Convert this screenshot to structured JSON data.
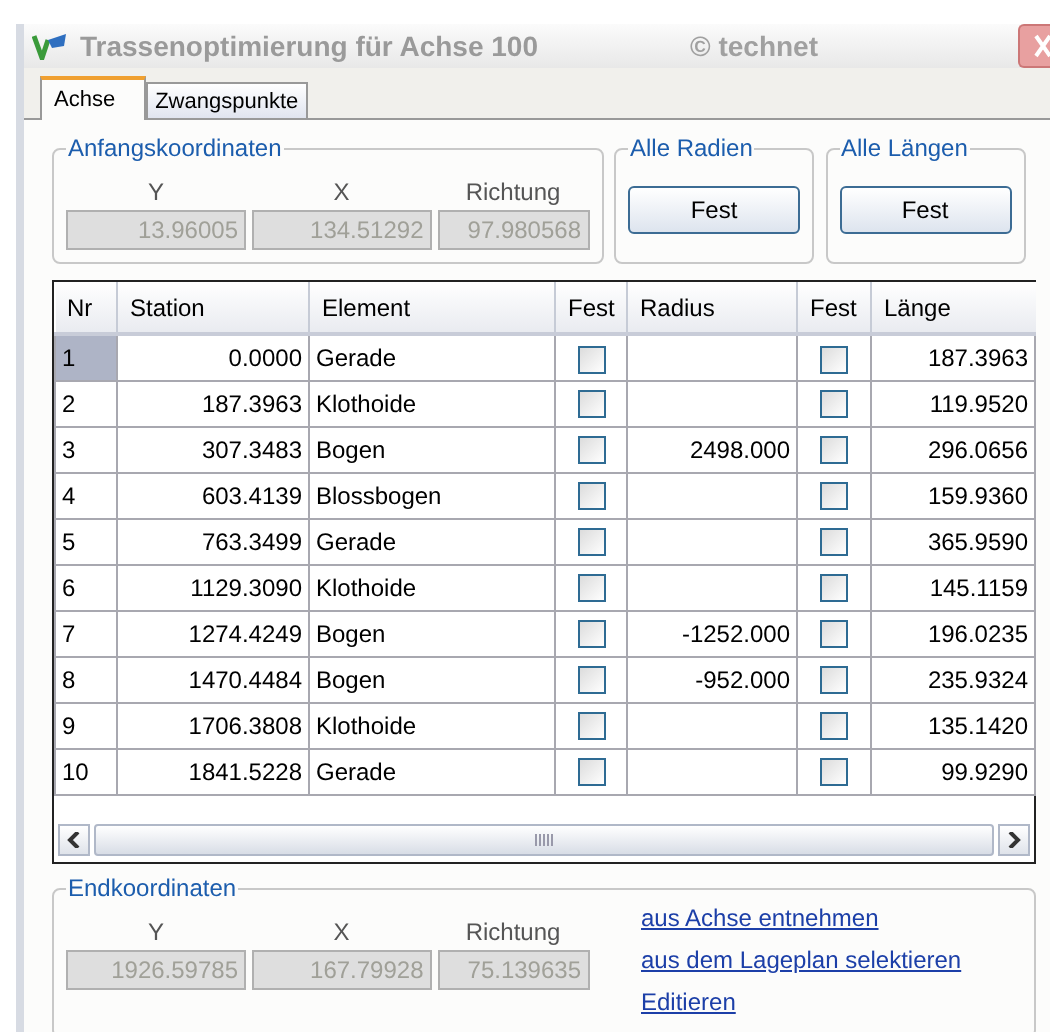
{
  "window": {
    "title": "Trassenoptimierung für Achse 100",
    "copyright": "© technet"
  },
  "tabs": [
    {
      "label": "Achse",
      "selected": true
    },
    {
      "label": "Zwangspunkte",
      "selected": false
    }
  ],
  "start_coordinates": {
    "title": "Anfangskoordinaten",
    "fields": [
      {
        "label": "Y",
        "value": "13.96005"
      },
      {
        "label": "X",
        "value": "134.51292"
      },
      {
        "label": "Richtung",
        "value": "97.980568"
      }
    ]
  },
  "radius_group": {
    "title": "Alle Radien",
    "button": "Fest"
  },
  "length_group": {
    "title": "Alle Längen",
    "button": "Fest"
  },
  "table": {
    "columns": [
      "Nr",
      "Station",
      "Element",
      "Fest",
      "Radius",
      "Fest",
      "Länge"
    ],
    "rows": [
      {
        "nr": "1",
        "station": "0.0000",
        "element": "Gerade",
        "fixed_radius": false,
        "fixed_length": false,
        "length": "187.3963",
        "selected": true
      },
      {
        "nr": "2",
        "station": "187.3963",
        "element": "Klothoide",
        "fixed_radius": false,
        "fixed_length": false,
        "length": "119.9520",
        "selected": false
      },
      {
        "nr": "3",
        "station": "307.3483",
        "element": "Bogen",
        "fixed_radius": false,
        "radius": "2498.000",
        "fixed_length": false,
        "length": "296.0656",
        "selected": false
      },
      {
        "nr": "4",
        "station": "603.4139",
        "element": "Blossbogen",
        "fixed_radius": false,
        "fixed_length": false,
        "length": "159.9360",
        "selected": false
      },
      {
        "nr": "5",
        "station": "763.3499",
        "element": "Gerade",
        "fixed_radius": false,
        "fixed_length": false,
        "length": "365.9590",
        "selected": false
      },
      {
        "nr": "6",
        "station": "1129.3090",
        "element": "Klothoide",
        "fixed_radius": false,
        "fixed_length": false,
        "length": "145.1159",
        "selected": false
      },
      {
        "nr": "7",
        "station": "1274.4249",
        "element": "Bogen",
        "fixed_radius": false,
        "radius": "-1252.000",
        "fixed_length": false,
        "length": "196.0235",
        "selected": false
      },
      {
        "nr": "8",
        "station": "1470.4484",
        "element": "Bogen",
        "fixed_radius": false,
        "radius": "-952.000",
        "fixed_length": false,
        "length": "235.9324",
        "selected": false
      },
      {
        "nr": "9",
        "station": "1706.3808",
        "element": "Klothoide",
        "fixed_radius": false,
        "fixed_length": false,
        "length": "135.1420",
        "selected": false
      },
      {
        "nr": "10",
        "station": "1841.5228",
        "element": "Gerade",
        "fixed_radius": false,
        "fixed_length": false,
        "length": "99.9290",
        "selected": false
      }
    ]
  },
  "end_coordinates": {
    "title": "Endkoordinaten",
    "fields": [
      {
        "label": "Y",
        "value": "1926.59785"
      },
      {
        "label": "X",
        "value": "167.79928"
      },
      {
        "label": "Richtung",
        "value": "75.139635"
      }
    ]
  },
  "links": [
    "aus Achse entnehmen",
    "aus dem Lageplan selektieren",
    "Editieren"
  ]
}
